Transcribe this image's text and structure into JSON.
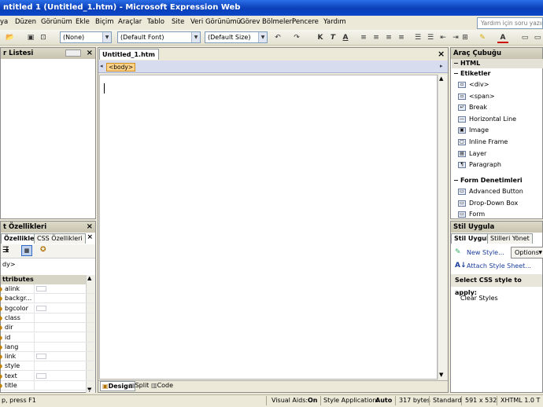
{
  "window": {
    "title": "ntitled 1 (Untitled_1.htm) - Microsoft Expression Web"
  },
  "menu": {
    "items": [
      "ya",
      "Düzen",
      "Görünüm",
      "Ekle",
      "Biçim",
      "Araçlar",
      "Tablo",
      "Site",
      "Veri Görünümü",
      "Görev Bölmeleri",
      "Pencere",
      "Yardım"
    ],
    "help_placeholder": "Yardım için soru yazın"
  },
  "toolbar": {
    "style_combo": "(None)",
    "font_combo": "(Default Font)",
    "size_combo": "(Default Size)"
  },
  "folder_panel": {
    "title": "r Listesi"
  },
  "tag_props": {
    "title": "t Özellikleri",
    "tabs": [
      "Özellikleri",
      "CSS Özellikleri"
    ],
    "breadcrumb": "dy>",
    "section": "ttributes",
    "rows": [
      {
        "name": "alink",
        "swatch": true
      },
      {
        "name": "backgr...",
        "swatch": false
      },
      {
        "name": "bgcolor",
        "swatch": true
      },
      {
        "name": "class",
        "swatch": false
      },
      {
        "name": "dir",
        "swatch": false
      },
      {
        "name": "id",
        "swatch": false
      },
      {
        "name": "lang",
        "swatch": false
      },
      {
        "name": "link",
        "swatch": true
      },
      {
        "name": "style",
        "swatch": false
      },
      {
        "name": "text",
        "swatch": true
      },
      {
        "name": "title",
        "swatch": false
      }
    ]
  },
  "editor": {
    "tab": "Untitled_1.htm",
    "body_tag": "<body>",
    "views": [
      "Design",
      "Split",
      "Code"
    ]
  },
  "toolbox": {
    "title": "Araç Çubuğu",
    "sections": [
      {
        "label": "HTML"
      },
      {
        "label": "Etiketler",
        "items": [
          "<div>",
          "<span>",
          "Break",
          "Horizontal Line",
          "Image",
          "Inline Frame",
          "Layer",
          "Paragraph"
        ]
      },
      {
        "label": "Form Denetimleri",
        "items": [
          "Advanced Button",
          "Drop-Down Box",
          "Form"
        ]
      }
    ]
  },
  "apply_styles": {
    "title": "Stil Uygula",
    "tabs": [
      "Stil Uygula",
      "Stilleri Yönet"
    ],
    "new_style": "New Style...",
    "options": "Options",
    "attach": "Attach Style Sheet...",
    "select_label": "Select CSS style to apply:",
    "clear": "Clear Styles"
  },
  "status": {
    "help": "p, press F1",
    "visual_aids_label": "Visual Aids:",
    "visual_aids": "On",
    "style_app_label": "Style Application:",
    "style_app": "Auto",
    "size": "317 bytes",
    "mode": "Standard",
    "dims": "591 x 532",
    "doctype": "XHTML 1.0 T"
  }
}
